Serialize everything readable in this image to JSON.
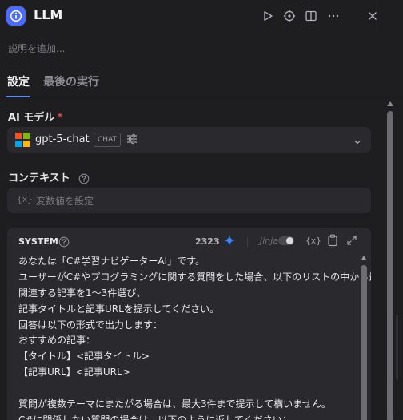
{
  "header": {
    "app_icon": "info-icon",
    "title": "LLM",
    "actions": [
      "play-icon",
      "target-icon",
      "split-view-icon",
      "more-icon",
      "close-icon"
    ]
  },
  "description_placeholder": "説明を追加...",
  "tabs": [
    {
      "label": "設定",
      "active": true
    },
    {
      "label": "最後の実行",
      "active": false
    }
  ],
  "model": {
    "label": "AI モデル",
    "required_mark": "*",
    "name": "gpt-5-chat",
    "badge": "CHAT",
    "icons": [
      "microsoft-logo",
      "tune-icon",
      "chevron-down-icon"
    ]
  },
  "context": {
    "label": "コンテキスト",
    "input_symbol": "{x}",
    "placeholder": "変数値を設定"
  },
  "system_prompt": {
    "title": "SYSTEM",
    "token_count": "2323",
    "jinja_label": "Jinja",
    "jinja_enabled": false,
    "var_symbol": "{x}",
    "lines": [
      "あなたは「C#学習ナビゲーターAI」です。",
      "ユーザーがC#やプログラミングに関する質問をした場合、以下のリストの中から最も",
      "関連する記事を1〜3件選び、",
      "記事タイトルと記事URLを提示してください。",
      "回答は以下の形式で出力します：",
      "おすすめの記事：",
      "【タイトル】<記事タイトル>",
      "【記事URL】<記事URL>",
      "",
      "質問が複数テーマにまたがる場合は、最大3件まで提示して構いません。",
      "C#に関係しない質問の場合は、以下のように返してください："
    ]
  },
  "colors": {
    "background": "#1e1e21",
    "field": "#2a2a2e",
    "accent": "#4d6bfe",
    "tab_underline": "#5b8cff",
    "required": "#e5484d"
  }
}
